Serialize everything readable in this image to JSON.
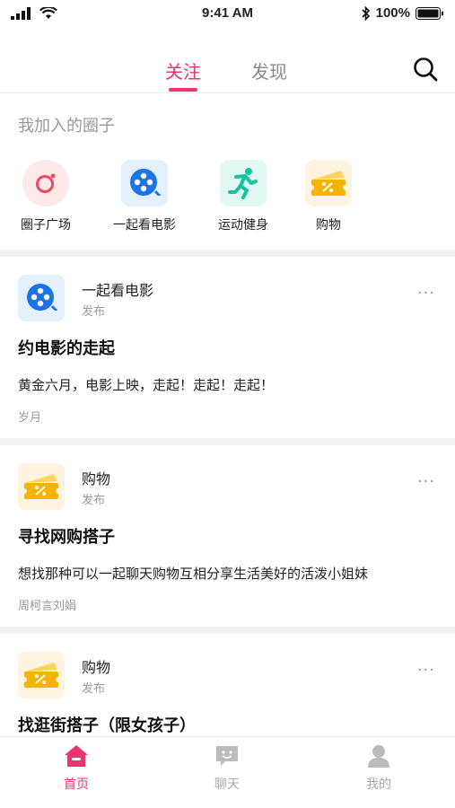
{
  "status_bar": {
    "time": "9:41 AM",
    "battery": "100%"
  },
  "nav": {
    "tab_follow": "关注",
    "tab_discover": "发现",
    "active_tab": "关注"
  },
  "circles": {
    "title": "我加入的圈子",
    "items": [
      {
        "label": "圈子广场",
        "icon": "circle-square-icon"
      },
      {
        "label": "一起看电影",
        "icon": "film-reel-icon"
      },
      {
        "label": "运动健身",
        "icon": "running-icon"
      },
      {
        "label": "购物",
        "icon": "coupon-icon"
      }
    ]
  },
  "posts": [
    {
      "circle": "一起看电影",
      "action": "发布",
      "title": "约电影的走起",
      "body": "黄金六月，电影上映，走起！走起！走起！",
      "author": "岁月",
      "icon": "film-reel-icon"
    },
    {
      "circle": "购物",
      "action": "发布",
      "title": "寻找网购搭子",
      "body": "想找那种可以一起聊天购物互相分享生活美好的活泼小姐妹",
      "author": "周柯言刘娟",
      "icon": "coupon-icon"
    },
    {
      "circle": "购物",
      "action": "发布",
      "title": "找逛街搭子（限女孩子）",
      "icon": "coupon-icon"
    }
  ],
  "more_label": "···",
  "bottom_nav": {
    "items": [
      {
        "label": "首页",
        "icon": "home-icon"
      },
      {
        "label": "聊天",
        "icon": "chat-icon"
      },
      {
        "label": "我的",
        "icon": "profile-icon"
      }
    ]
  },
  "colors": {
    "accent": "#f0336e",
    "film_blue": "#1a73e8",
    "coupon_yellow": "#f5b400",
    "sport_green": "#17c2a0"
  }
}
